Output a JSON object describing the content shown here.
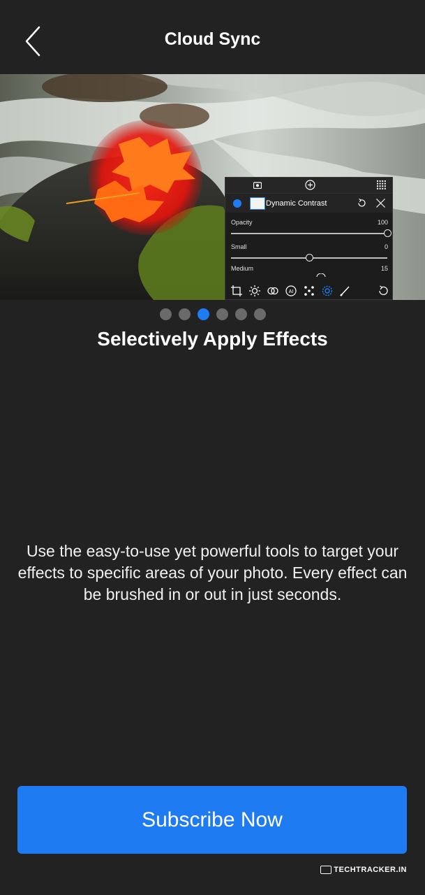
{
  "header": {
    "title": "Cloud Sync"
  },
  "panel": {
    "layer_name": "Dynamic Contrast",
    "sliders": [
      {
        "label": "Opacity",
        "value": "100",
        "fraction": 1.0
      },
      {
        "label": "Small",
        "value": "0",
        "fraction": 0.5
      },
      {
        "label": "Medium",
        "value": "15",
        "fraction": 0.5
      }
    ]
  },
  "pager": {
    "count": 6,
    "active_index": 2
  },
  "slide": {
    "title": "Selectively Apply Effects",
    "description": "Use the easy-to-use yet powerful tools to target your effects to specific areas of your photo. Every effect can be brushed in or out in just seconds."
  },
  "cta": {
    "label": "Subscribe Now"
  },
  "watermark": {
    "text": "TECHTRACKER.IN"
  },
  "colors": {
    "background": "#222222",
    "accent": "#1e7bf2"
  }
}
